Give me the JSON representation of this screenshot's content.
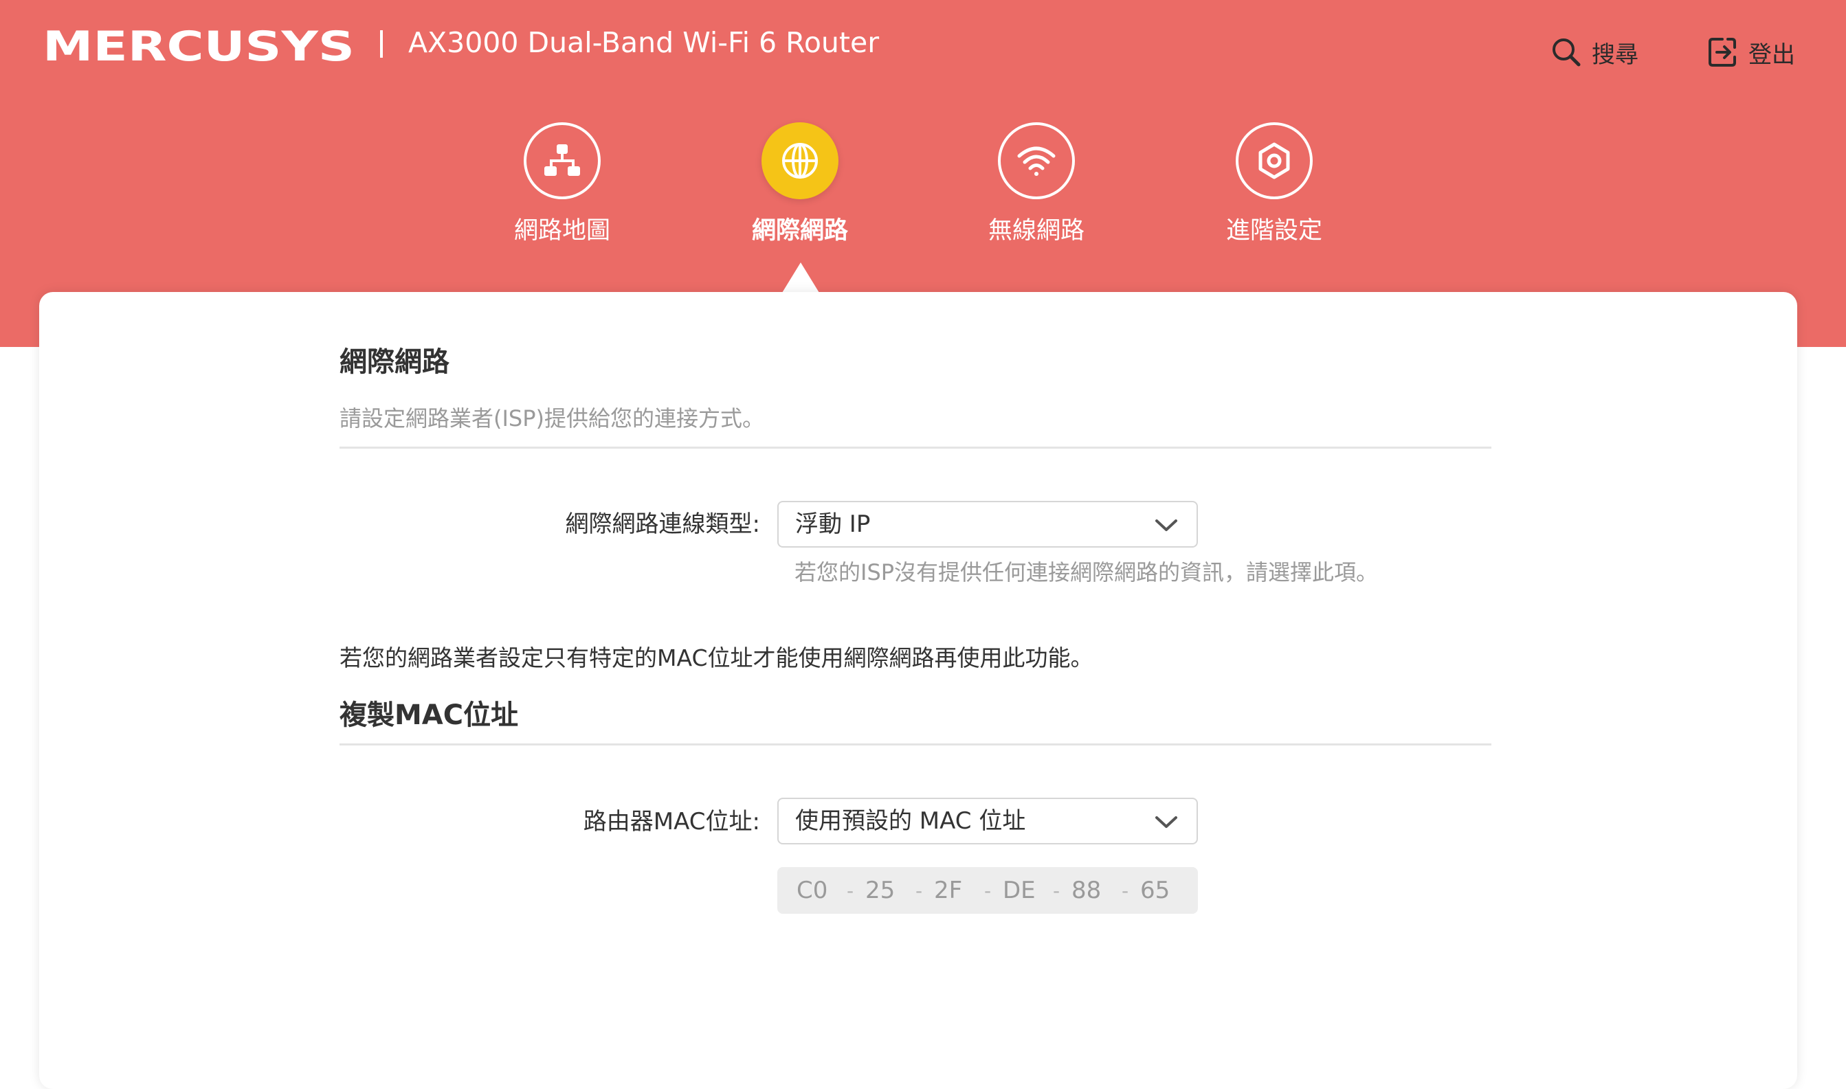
{
  "header": {
    "brand": "MERCUSYS",
    "product_title": "AX3000 Dual-Band Wi-Fi 6 Router",
    "search_label": "搜尋",
    "search_icon": "search-icon",
    "logout_label": "登出",
    "logout_icon": "logout-icon"
  },
  "nav": {
    "items": [
      {
        "label": "網路地圖",
        "icon": "network-map-icon",
        "active": false
      },
      {
        "label": "網際網路",
        "icon": "globe-icon",
        "active": true
      },
      {
        "label": "無線網路",
        "icon": "wifi-icon",
        "active": false
      },
      {
        "label": "進階設定",
        "icon": "gear-icon",
        "active": false
      }
    ]
  },
  "internet": {
    "title": "網際網路",
    "description": "請設定網路業者(ISP)提供給您的連接方式。",
    "connection_type_label": "網際網路連線類型:",
    "connection_type_value": "浮動 IP",
    "connection_type_hint": "若您的ISP沒有提供任何連接網際網路的資訊，請選擇此項。"
  },
  "mac_clone": {
    "note": "若您的網路業者設定只有特定的MAC位址才能使用網際網路再使用此功能。",
    "title": "複製MAC位址",
    "router_mac_label": "路由器MAC位址:",
    "router_mac_value": "使用預設的 MAC 位址",
    "mac_segments": [
      "C0",
      "25",
      "2F",
      "DE",
      "88",
      "65"
    ],
    "separator": "-"
  },
  "colors": {
    "header_bg": "#EB6B66",
    "active_nav": "#F5C417",
    "text_primary": "#333333",
    "text_secondary": "#9A9A9A"
  }
}
